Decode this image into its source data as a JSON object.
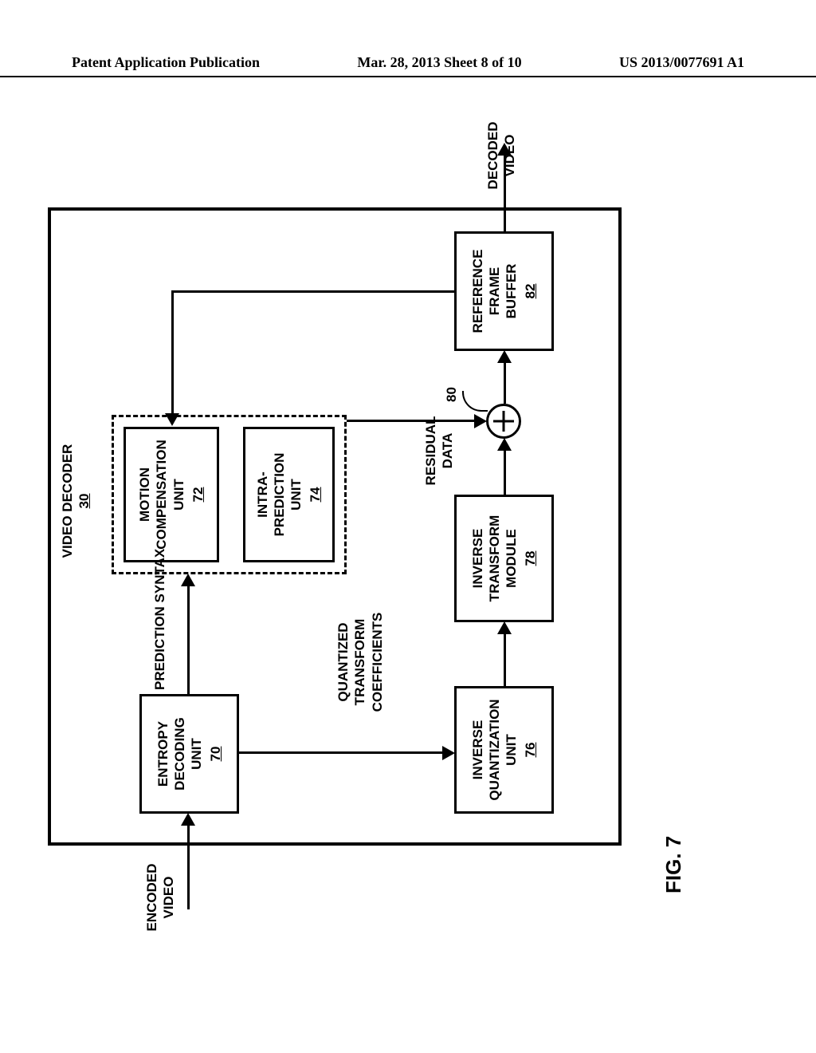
{
  "header": {
    "left": "Patent Application Publication",
    "center": "Mar. 28, 2013  Sheet 8 of 10",
    "right": "US 2013/0077691 A1"
  },
  "figure_label": "FIG. 7",
  "diagram": {
    "title": "VIDEO DECODER",
    "title_ref": "30",
    "input_label": "ENCODED\nVIDEO",
    "output_label": "DECODED\nVIDEO",
    "sum_ref": "80",
    "labels": {
      "prediction_syntax": "PREDICTION SYNTAX",
      "quantized": "QUANTIZED\nTRANSFORM\nCOEFFICIENTS",
      "residual": "RESIDUAL\nDATA"
    },
    "blocks": {
      "entropy": {
        "name": "ENTROPY\nDECODING\nUNIT",
        "ref": "70"
      },
      "motion": {
        "name": "MOTION\nCOMPENSATION\nUNIT",
        "ref": "72"
      },
      "intra": {
        "name": "INTRA-\nPREDICTION\nUNIT",
        "ref": "74"
      },
      "iquant": {
        "name": "INVERSE\nQUANTIZATION\nUNIT",
        "ref": "76"
      },
      "itrans": {
        "name": "INVERSE\nTRANSFORM\nMODULE",
        "ref": "78"
      },
      "refbuf": {
        "name": "REFERENCE\nFRAME\nBUFFER",
        "ref": "82"
      }
    }
  }
}
